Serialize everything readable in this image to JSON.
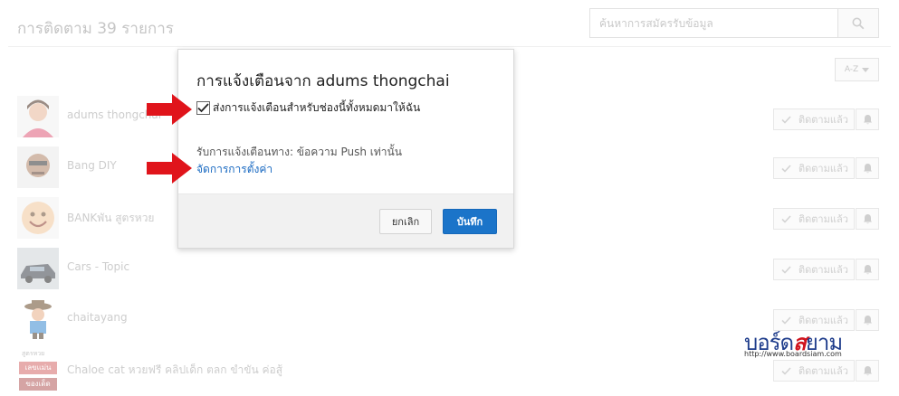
{
  "page": {
    "title": "การติดตาม 39 รายการ",
    "search_placeholder": "ค้นหาการสมัครรับข้อมูล",
    "sort_label": "A-Z"
  },
  "subscriptions": [
    {
      "name": "adums thongchai",
      "button_label": "ติดตามแล้ว"
    },
    {
      "name": "Bang DIY",
      "button_label": "ติดตามแล้ว"
    },
    {
      "name": "BANKพัน สูตรหวย",
      "button_label": "ติดตามแล้ว"
    },
    {
      "name": "Cars - Topic",
      "button_label": "ติดตามแล้ว"
    },
    {
      "name": "chaitayang",
      "button_label": "ติดตามแล้ว"
    },
    {
      "name": "Chaloe cat หวยฟรี คลิปเด็ก ตลก ขำขัน ค่อสู้",
      "button_label": "ติดตามแล้ว"
    }
  ],
  "dialog": {
    "title": "การแจ้งเตือนจาก adums thongchai",
    "checkbox_label": "ส่งการแจ้งเตือนสำหรับช่องนี้ทั้งหมดมาให้ฉัน",
    "checkbox_checked": true,
    "delivery_text": "รับการแจ้งเตือนทาง: ข้อความ Push เท่านั้น",
    "manage_link": "จัดการการตั้งค่า",
    "cancel_label": "ยกเลิก",
    "save_label": "บันทึก"
  },
  "colors": {
    "save_button": "#1b74c9",
    "link": "#1a6ac2",
    "annotation_arrow": "#e0141b"
  },
  "watermark": {
    "brand_prefix": "บอร์ด",
    "brand_highlight": "ส",
    "brand_suffix": "ยาม",
    "url": "http://www.boardsiam.com"
  },
  "avatar_overlay_text": {
    "top": "สูตรหวย",
    "middle": "เลขแม่น",
    "bottom": "ของเด็ด"
  }
}
